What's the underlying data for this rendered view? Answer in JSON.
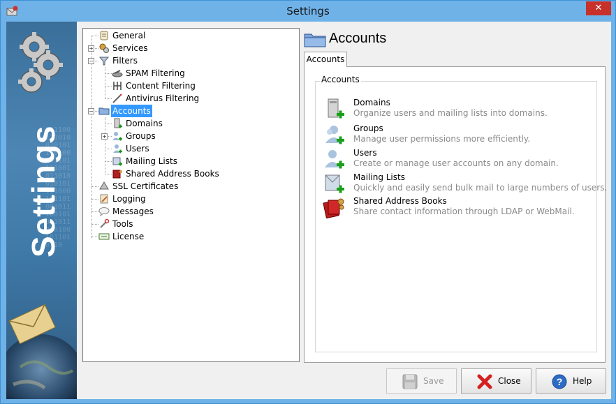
{
  "window": {
    "title": "Settings",
    "close_glyph": "✕"
  },
  "banner": {
    "text": "Settings",
    "binary": "1011001110100101011101001011011110010110100101011110001011010010111001010010110101001011010110"
  },
  "tree": {
    "items": [
      {
        "label": "General",
        "icon": "scroll-icon"
      },
      {
        "label": "Services",
        "icon": "services-icon"
      },
      {
        "label": "Filters",
        "icon": "filter-icon"
      },
      {
        "label": "SPAM Filtering",
        "icon": "spam-filter-icon"
      },
      {
        "label": "Content Filtering",
        "icon": "content-filter-icon"
      },
      {
        "label": "Antivirus Filtering",
        "icon": "antivirus-icon"
      },
      {
        "label": "Accounts",
        "icon": "folder-icon"
      },
      {
        "label": "Domains",
        "icon": "domain-icon"
      },
      {
        "label": "Groups",
        "icon": "group-icon"
      },
      {
        "label": "Users",
        "icon": "user-icon"
      },
      {
        "label": "Mailing Lists",
        "icon": "mailing-list-icon"
      },
      {
        "label": "Shared Address Books",
        "icon": "address-book-icon"
      },
      {
        "label": "SSL Certificates",
        "icon": "certificate-icon"
      },
      {
        "label": "Logging",
        "icon": "log-icon"
      },
      {
        "label": "Messages",
        "icon": "message-icon"
      },
      {
        "label": "Tools",
        "icon": "tools-icon"
      },
      {
        "label": "License",
        "icon": "license-icon"
      }
    ],
    "selected": "Accounts"
  },
  "content": {
    "title": "Accounts",
    "tab_label": "Accounts",
    "group_label": "Accounts",
    "items": [
      {
        "title": "Domains",
        "desc": "Organize users and mailing lists into domains."
      },
      {
        "title": "Groups",
        "desc": "Manage user permissions more efficiently."
      },
      {
        "title": "Users",
        "desc": "Create or manage user accounts on any domain."
      },
      {
        "title": "Mailing Lists",
        "desc": "Quickly and easily send bulk mail to large numbers of users."
      },
      {
        "title": "Shared Address Books",
        "desc": "Share contact information through LDAP or WebMail."
      }
    ]
  },
  "buttons": {
    "save": "Save",
    "close": "Close",
    "help": "Help"
  },
  "colors": {
    "titlebar": "#6fb2e8",
    "selection": "#3399ff",
    "close": "#c7312a"
  }
}
